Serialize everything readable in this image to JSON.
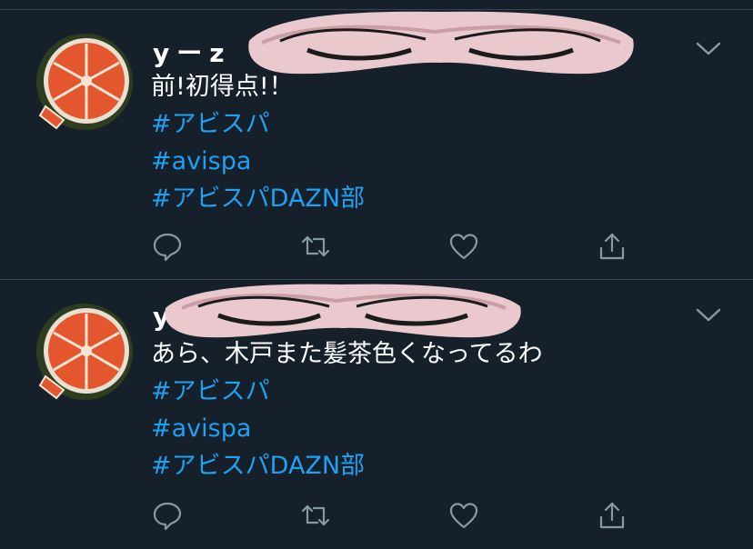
{
  "tweets": [
    {
      "author": "yーz",
      "text": "前!初得点!！",
      "hashtags": [
        "#アビスパ",
        "#avispa",
        "#アビスパDAZN部"
      ],
      "actions": [
        "reply-icon",
        "retweet-icon",
        "like-icon",
        "share-icon"
      ]
    },
    {
      "author": "y",
      "text": "あら、木戸また髪茶色くなってるわ",
      "hashtags": [
        "#アビスパ",
        "#avispa",
        "#アビスパDAZN部"
      ],
      "actions": [
        "reply-icon",
        "retweet-icon",
        "like-icon",
        "share-icon"
      ]
    }
  ],
  "colors": {
    "background": "#15202b",
    "text": "#ffffff",
    "hashtag": "#1da1f2",
    "icon": "#8899a6",
    "divider": "#38444d"
  }
}
